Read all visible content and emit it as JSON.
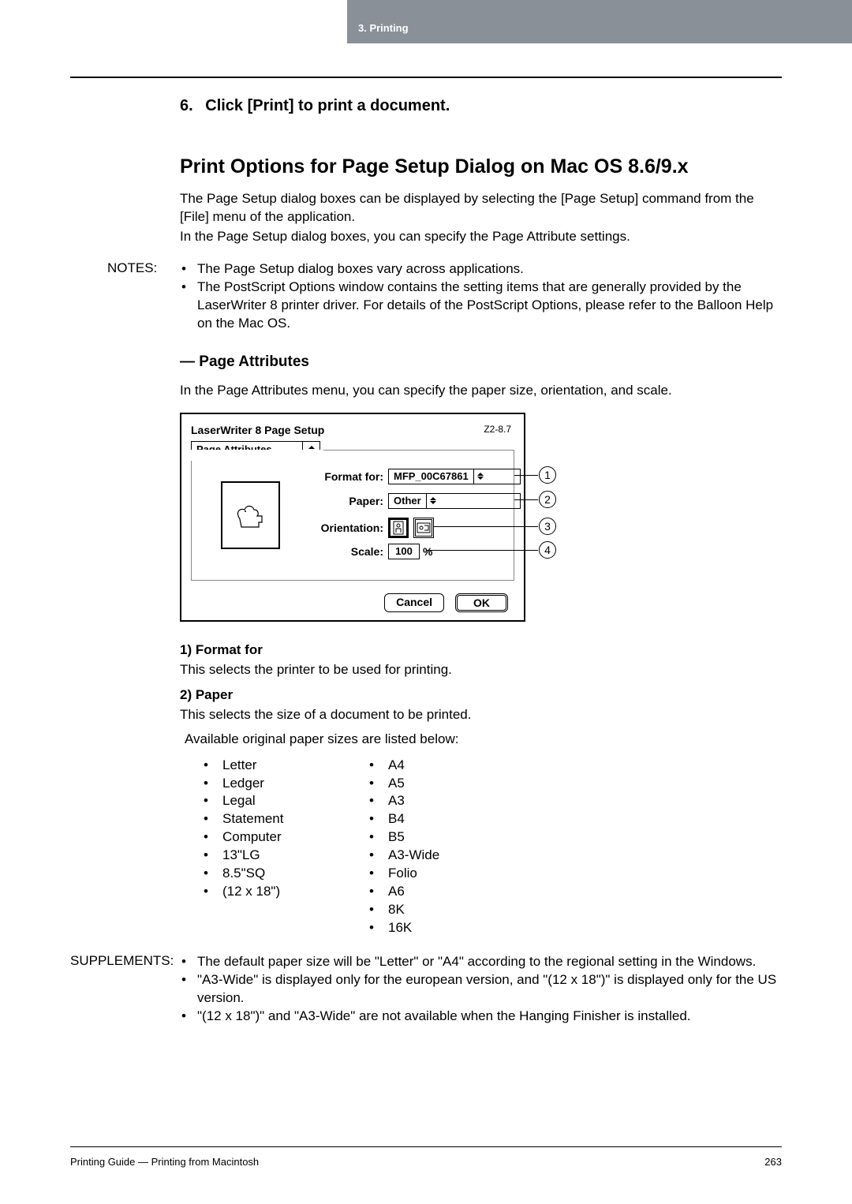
{
  "header": {
    "chapter": "3.  Printing"
  },
  "step": {
    "number": "6.",
    "text": "Click [Print] to print a document."
  },
  "h2": "Print Options for Page Setup Dialog on Mac OS 8.6/9.x",
  "intro_p1": "The Page Setup dialog boxes can be displayed by selecting the [Page Setup] command from the [File] menu of the application.",
  "intro_p2": "In the Page Setup dialog boxes, you can specify the Page Attribute settings.",
  "labels": {
    "notes": "NOTES:",
    "supplements": "SUPPLEMENTS:"
  },
  "notes": [
    "The Page Setup dialog boxes vary across applications.",
    "The PostScript Options window contains the setting items that are generally provided by the LaserWriter 8 printer driver.  For details of the PostScript Options, please refer to the Balloon Help on the Mac OS."
  ],
  "h3": "— Page Attributes",
  "attr_intro": "In the Page Attributes menu, you can specify the paper size, orientation, and scale.",
  "dialog": {
    "title": "LaserWriter 8 Page Setup",
    "version": "Z2-8.7",
    "tab": "Page Attributes",
    "format_for_label": "Format for:",
    "format_for_value": "MFP_00C67861",
    "paper_label": "Paper:",
    "paper_value": "Other",
    "orientation_label": "Orientation:",
    "scale_label": "Scale:",
    "scale_value": "100",
    "scale_unit": "%",
    "cancel": "Cancel",
    "ok": "OK"
  },
  "callouts": {
    "c1": "1",
    "c2": "2",
    "c3": "3",
    "c4": "4"
  },
  "defs": {
    "h1": "1)  Format for",
    "b1": "This selects the printer to be used for printing.",
    "h2": "2)  Paper",
    "b2": "This selects the size of a document to be printed.",
    "b2b": "Available original paper sizes are listed below:"
  },
  "paper_sizes": {
    "col1": [
      "Letter",
      "Ledger",
      "Legal",
      "Statement",
      "Computer",
      "13\"LG",
      "8.5\"SQ",
      "(12 x 18\")"
    ],
    "col2": [
      "A4",
      "A5",
      "A3",
      "B4",
      "B5",
      "A3-Wide",
      "Folio",
      "A6",
      "8K",
      "16K"
    ]
  },
  "supplements": [
    "The default paper size will be \"Letter\" or \"A4\" according to the regional setting in the Windows.",
    "\"A3-Wide\" is displayed only for the european version, and \"(12 x 18\")\" is displayed only for the US version.",
    "\"(12 x 18\")\" and \"A3-Wide\" are not available when the Hanging Finisher is installed."
  ],
  "footer": {
    "left": "Printing Guide — Printing from Macintosh",
    "right": "263"
  }
}
